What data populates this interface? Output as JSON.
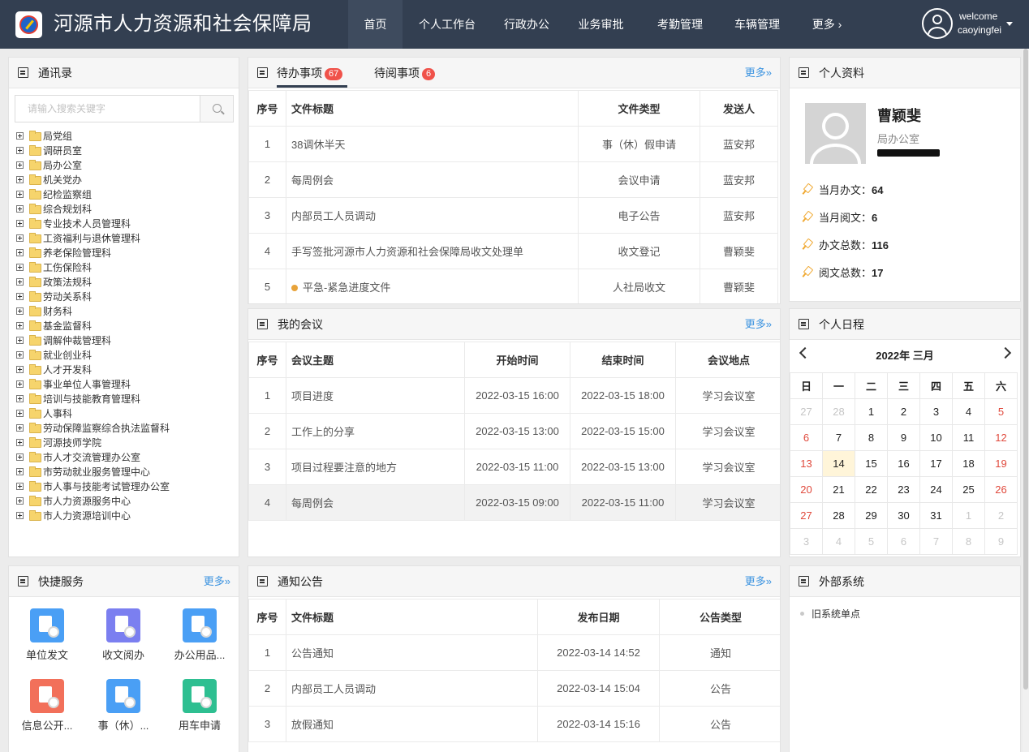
{
  "header": {
    "title": "河源市人力资源和社会保障局",
    "nav": [
      {
        "label": "首页",
        "active": true
      },
      {
        "label": "个人工作台"
      },
      {
        "label": "行政办公"
      },
      {
        "label": "业务审批"
      },
      {
        "label": "考勤管理"
      },
      {
        "label": "车辆管理"
      },
      {
        "label": "更多 ›"
      }
    ],
    "user": {
      "welcome": "welcome",
      "username": "caoyingfei"
    }
  },
  "contacts": {
    "title": "通讯录",
    "search_placeholder": "请输入搜索关键字",
    "tree": [
      "局党组",
      "调研员室",
      "局办公室",
      "机关党办",
      "纪检监察组",
      "综合规划科",
      "专业技术人员管理科",
      "工资福利与退休管理科",
      "养老保险管理科",
      "工伤保险科",
      "政策法规科",
      "劳动关系科",
      "财务科",
      "基金监督科",
      "调解仲裁管理科",
      "就业创业科",
      "人才开发科",
      "事业单位人事管理科",
      "培训与技能教育管理科",
      "人事科",
      "劳动保障监察综合执法监督科",
      "河源技师学院",
      "市人才交流管理办公室",
      "市劳动就业服务管理中心",
      "市人事与技能考试管理办公室",
      "市人力资源服务中心",
      "市人力资源培训中心"
    ]
  },
  "todo": {
    "tabs": [
      {
        "label": "待办事项",
        "badge": "67"
      },
      {
        "label": "待阅事项",
        "badge": "6"
      }
    ],
    "more": "更多»",
    "columns": [
      "序号",
      "文件标题",
      "文件类型",
      "发送人"
    ],
    "rows": [
      {
        "no": "1",
        "title": "38调休半天",
        "type": "事（休）假申请",
        "sender": "蓝安邦"
      },
      {
        "no": "2",
        "title": "每周例会",
        "type": "会议申请",
        "sender": "蓝安邦"
      },
      {
        "no": "3",
        "title": "内部员工人员调动",
        "type": "电子公告",
        "sender": "蓝安邦"
      },
      {
        "no": "4",
        "title": "手写签批河源市人力资源和社会保障局收文处理单",
        "type": "收文登记",
        "sender": "曹颖斐"
      },
      {
        "no": "5",
        "title": "平急-紧急进度文件",
        "type": "人社局收文",
        "sender": "曹颖斐"
      }
    ]
  },
  "meetings": {
    "title": "我的会议",
    "more": "更多»",
    "columns": [
      "序号",
      "会议主题",
      "开始时间",
      "结束时间",
      "会议地点"
    ],
    "rows": [
      {
        "no": "1",
        "topic": "项目进度",
        "start": "2022-03-15 16:00",
        "end": "2022-03-15 18:00",
        "place": "学习会议室"
      },
      {
        "no": "2",
        "topic": "工作上的分享",
        "start": "2022-03-15 13:00",
        "end": "2022-03-15 15:00",
        "place": "学习会议室"
      },
      {
        "no": "3",
        "topic": "项目过程要注意的地方",
        "start": "2022-03-15 11:00",
        "end": "2022-03-15 13:00",
        "place": "学习会议室"
      },
      {
        "no": "4",
        "topic": "每周例会",
        "start": "2022-03-15 09:00",
        "end": "2022-03-15 11:00",
        "place": "学习会议室"
      }
    ]
  },
  "notices": {
    "title": "通知公告",
    "more": "更多»",
    "columns": [
      "序号",
      "文件标题",
      "发布日期",
      "公告类型"
    ],
    "rows": [
      {
        "no": "1",
        "title": "公告通知",
        "date": "2022-03-14 14:52",
        "type": "通知"
      },
      {
        "no": "2",
        "title": "内部员工人员调动",
        "date": "2022-03-14 15:04",
        "type": "公告"
      },
      {
        "no": "3",
        "title": "放假通知",
        "date": "2022-03-14 15:16",
        "type": "公告"
      }
    ]
  },
  "profile": {
    "title": "个人资料",
    "name": "曹颖斐",
    "dept": "局办公室",
    "stats": [
      {
        "label": "当月办文：",
        "value": "64"
      },
      {
        "label": "当月阅文：",
        "value": "6"
      },
      {
        "label": "办文总数：",
        "value": "116"
      },
      {
        "label": "阅文总数：",
        "value": "17"
      }
    ]
  },
  "schedule": {
    "title": "个人日程",
    "month_label": "2022年 三月",
    "weekdays": [
      "日",
      "一",
      "二",
      "三",
      "四",
      "五",
      "六"
    ],
    "weeks": [
      [
        "27",
        "28",
        "1",
        "2",
        "3",
        "4",
        "5"
      ],
      [
        "6",
        "7",
        "8",
        "9",
        "10",
        "11",
        "12"
      ],
      [
        "13",
        "14",
        "15",
        "16",
        "17",
        "18",
        "19"
      ],
      [
        "20",
        "21",
        "22",
        "23",
        "24",
        "25",
        "26"
      ],
      [
        "27",
        "28",
        "29",
        "30",
        "31",
        "1",
        "2"
      ],
      [
        "3",
        "4",
        "5",
        "6",
        "7",
        "8",
        "9"
      ]
    ]
  },
  "quick_services": {
    "title": "快捷服务",
    "more": "更多»",
    "items": [
      {
        "label": "单位发文",
        "color": "#4a9ff5"
      },
      {
        "label": "收文阅办",
        "color": "#7b7ff0"
      },
      {
        "label": "办公用品...",
        "color": "#4a9ff5"
      },
      {
        "label": "信息公开...",
        "color": "#f2705a"
      },
      {
        "label": "事（休）...",
        "color": "#4a9ff5"
      },
      {
        "label": "用车申请",
        "color": "#2ebf91"
      }
    ]
  },
  "external": {
    "title": "外部系统",
    "items": [
      "旧系统单点"
    ]
  }
}
